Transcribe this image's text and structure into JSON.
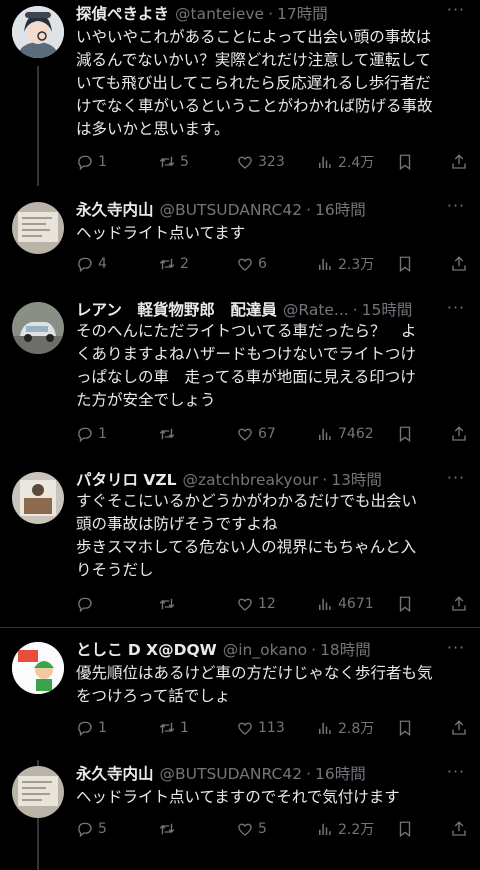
{
  "tweets": [
    {
      "name": "探偵ぺきよき",
      "handle": "@tanteieve",
      "time": "17時間",
      "text": "いやいやこれがあることによって出会い頭の事故は\n減るんでないかい？実際どれだけ注意して運転して\nいても飛び出してこられたら反応遅れるし歩行者だ\nけでなく車がいるということがわかれば防げる事故\nは多いかと思います。",
      "replies": "1",
      "retweets": "5",
      "likes": "323",
      "views": "2.4万"
    },
    {
      "name": "永久寺内山",
      "handle": "@BUTSUDANRC42",
      "time": "16時間",
      "text": "ヘッドライト点いてます",
      "replies": "4",
      "retweets": "2",
      "likes": "6",
      "views": "2.3万"
    },
    {
      "name": "レアン　軽貨物野郎　配達員",
      "handle": "@Rate...",
      "time": "15時間",
      "text": "そのへんにただライトついてる車だったら？　よ\nくありますよねハザードもつけないでライトつけ\nっぱなしの車　走ってる車が地面に見える印つけ\nた方が安全でしょう",
      "replies": "1",
      "retweets": "",
      "likes": "67",
      "views": "7462"
    },
    {
      "name": "パタリロ VZL",
      "handle": "@zatchbreakyour",
      "time": "13時間",
      "text": "すぐそこにいるかどうかがわかるだけでも出会い\n頭の事故は防げそうですよね\n歩きスマホしてる危ない人の視界にもちゃんと入\nりそうだし",
      "replies": "",
      "retweets": "",
      "likes": "12",
      "views": "4671"
    },
    {
      "name": "としこ D X@DQW",
      "handle": "@in_okano",
      "time": "18時間",
      "text": "優先順位はあるけど車の方だけじゃなく歩行者も気\nをつけろって話でしょ",
      "replies": "1",
      "retweets": "1",
      "likes": "113",
      "views": "2.8万"
    },
    {
      "name": "永久寺内山",
      "handle": "@BUTSUDANRC42",
      "time": "16時間",
      "text": "ヘッドライト点いてますのでそれで気付けます",
      "replies": "5",
      "retweets": "",
      "likes": "5",
      "views": "2.2万"
    }
  ],
  "colors": {
    "background": "#000000",
    "text": "#e7e9ea",
    "secondary": "#71767b",
    "divider": "#2f3336"
  },
  "icons": [
    "reply-icon",
    "retweet-icon",
    "like-icon",
    "views-icon",
    "bookmark-icon",
    "share-icon",
    "more-icon"
  ]
}
